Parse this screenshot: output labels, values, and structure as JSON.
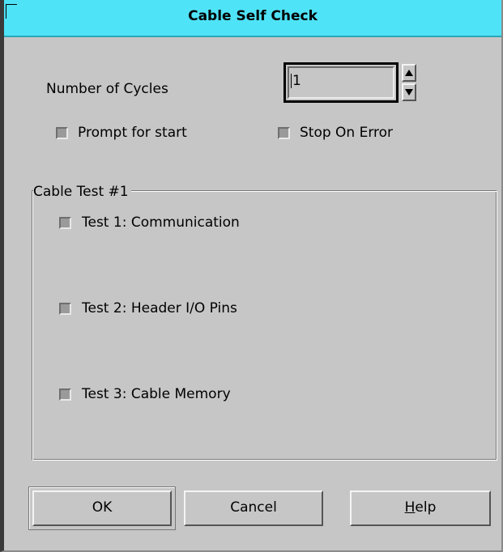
{
  "window": {
    "title": "Cable Self Check"
  },
  "cycles": {
    "label": "Number of Cycles",
    "value": "1"
  },
  "options": {
    "prompt_label": "Prompt for start",
    "stop_label": "Stop On Error"
  },
  "group": {
    "legend": "Cable Test #1",
    "tests": [
      {
        "label": "Test 1: Communication"
      },
      {
        "label": "Test 2: Header I/O Pins"
      },
      {
        "label": "Test 3: Cable Memory"
      }
    ]
  },
  "buttons": {
    "ok": "OK",
    "cancel": "Cancel",
    "help_mnemonic": "H",
    "help_rest": "elp"
  },
  "colors": {
    "titlebar": "#4fe3f7",
    "dialog_bg": "#c6c6c6"
  }
}
